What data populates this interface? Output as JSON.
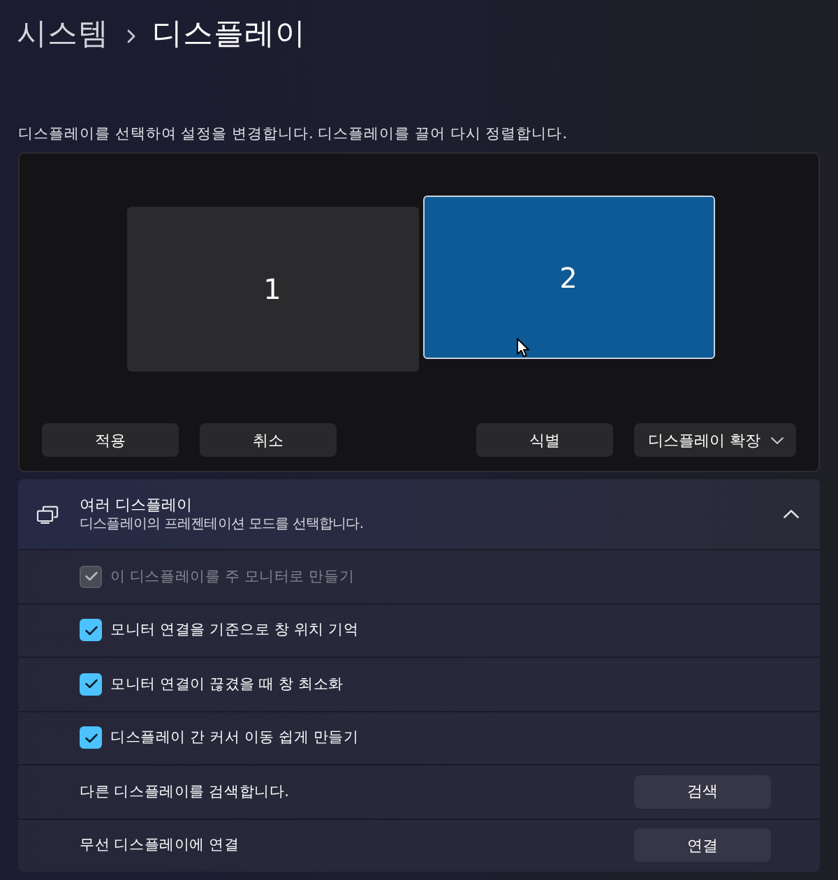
{
  "breadcrumb": {
    "parent": "시스템",
    "current": "디스플레이"
  },
  "description": "디스플레이를 선택하여 설정을 변경합니다. 디스플레이를 끌어 다시 정렬합니다.",
  "arrangement": {
    "monitors": [
      {
        "label": "1",
        "selected": false
      },
      {
        "label": "2",
        "selected": true
      }
    ],
    "buttons": [
      {
        "label": "적용"
      },
      {
        "label": "취소"
      }
    ],
    "identify_button": {
      "label": "식별"
    },
    "mode_dropdown": {
      "value": "디스플레이 확장"
    }
  },
  "multiple_displays": {
    "title": "여러 디스플레이",
    "subtitle": "디스플레이의 프레젠테이션 모드를 선택합니다.",
    "expanded": true,
    "options": [
      {
        "kind": "checkbox",
        "label": "이 디스플레이를 주 모니터로 만들기",
        "checked": true,
        "disabled": true
      },
      {
        "kind": "checkbox",
        "label": "모니터 연결을 기준으로 창 위치 기억",
        "checked": true,
        "disabled": false
      },
      {
        "kind": "checkbox",
        "label": "모니터 연결이 끊겼을 때 창 최소화",
        "checked": true,
        "disabled": false
      },
      {
        "kind": "checkbox",
        "label": "디스플레이 간 커서 이동 쉽게 만들기",
        "checked": true,
        "disabled": false
      },
      {
        "kind": "action",
        "label": "다른 디스플레이를 검색합니다.",
        "button": "검색"
      },
      {
        "kind": "action",
        "label": "무선 디스플레이에 연결",
        "button": "연결"
      }
    ]
  }
}
